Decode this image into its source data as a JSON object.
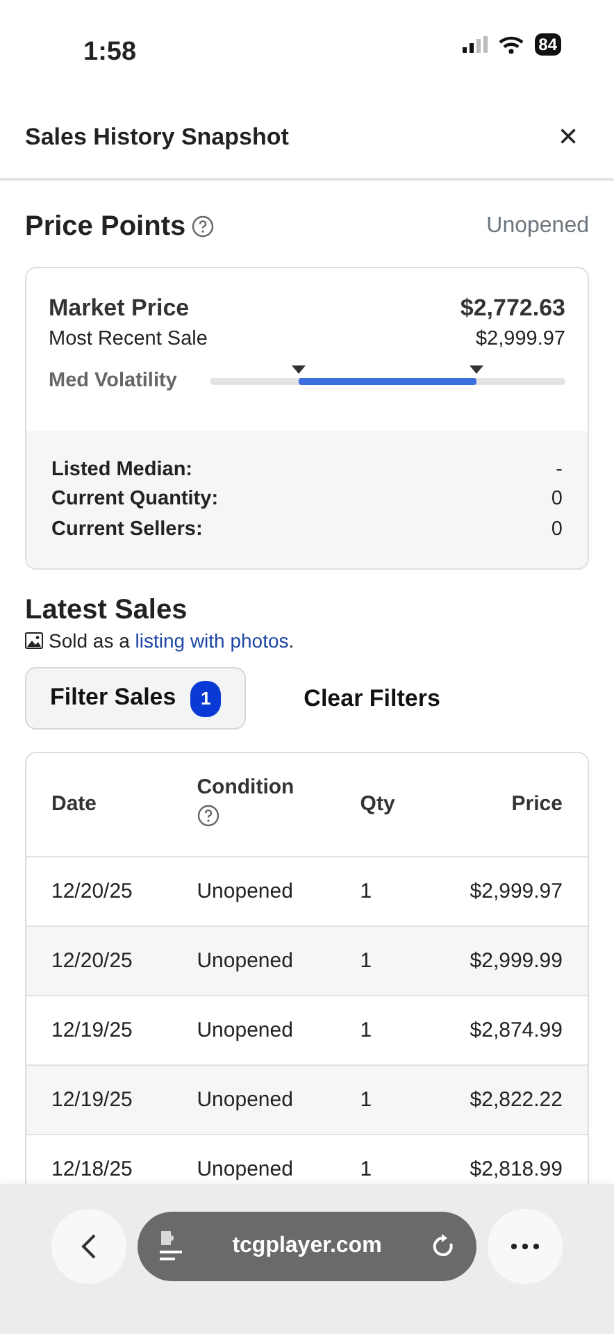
{
  "status_bar": {
    "time": "1:58",
    "battery": "84"
  },
  "header": {
    "title": "Sales History Snapshot",
    "close": "×"
  },
  "price_points": {
    "title": "Price Points",
    "condition": "Unopened",
    "market_label": "Market Price",
    "market_value": "$2,772.63",
    "recent_label": "Most Recent Sale",
    "recent_value": "$2,999.97",
    "volatility": {
      "label": "Med Volatility",
      "level": 0.5
    },
    "stats": [
      {
        "label": "Listed Median:",
        "value": "-"
      },
      {
        "label": "Current Quantity:",
        "value": "0"
      },
      {
        "label": "Current Sellers:",
        "value": "0"
      }
    ]
  },
  "latest_sales": {
    "title": "Latest Sales",
    "note": "Sold as a ",
    "link": "listing with photos",
    "note_end": ".",
    "filter_button": "Filter Sales",
    "filter_count": "1",
    "clear_button": "Clear Filters",
    "table": {
      "columns": [
        "Date",
        "Condition",
        "Qty",
        "Price"
      ],
      "rows": [
        [
          "12/20/25",
          "Unopened",
          "1",
          "$2,999.97"
        ],
        [
          "12/20/25",
          "Unopened",
          "1",
          "$2,999.99"
        ],
        [
          "12/19/25",
          "Unopened",
          "1",
          "$2,874.99"
        ],
        [
          "12/19/25",
          "Unopened",
          "1",
          "$2,822.22"
        ],
        [
          "12/18/25",
          "Unopened",
          "1",
          "$2,818.99"
        ]
      ]
    }
  },
  "browser_bar": {
    "url": "tcgplayer.com"
  }
}
